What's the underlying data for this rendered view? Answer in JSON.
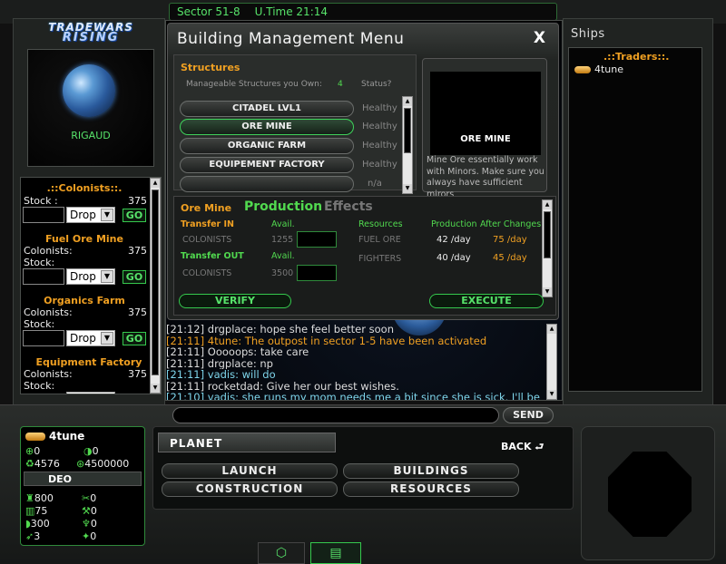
{
  "header": {
    "sector": "Sector 51-8",
    "utime": "U.Time 21:14"
  },
  "logo": {
    "line1": "TRADEWARS",
    "line2": "RISING"
  },
  "planet": {
    "name": "RIGAUD"
  },
  "colonists_panel": {
    "title": ".::Colonists::.",
    "sections": [
      {
        "heading": "",
        "rows": [
          {
            "label": "Stock :",
            "value": "375"
          }
        ]
      },
      {
        "heading": "Fuel Ore Mine",
        "rows": [
          {
            "label": "Colonists:",
            "value": "375"
          },
          {
            "label": "Stock:",
            "value": ""
          }
        ]
      },
      {
        "heading": "Organics Farm",
        "rows": [
          {
            "label": "Colonists:",
            "value": "375"
          },
          {
            "label": "Stock:",
            "value": ""
          }
        ]
      },
      {
        "heading": "Equipment Factory",
        "rows": [
          {
            "label": "Colonists:",
            "value": "375"
          },
          {
            "label": "Stock:",
            "value": ""
          }
        ]
      }
    ],
    "drop_label": "Drop",
    "go_label": "GO"
  },
  "modal": {
    "title": "Building Management Menu",
    "title_ghost": "Building Management Menu",
    "close": "X",
    "structures_heading": "Structures",
    "manageable_label": "Manageable Structures you Own:",
    "manageable_count": "4",
    "status_label": "Status?",
    "structures": [
      {
        "name": "CITADEL LVL1",
        "status": "Healthy"
      },
      {
        "name": "ORE MINE",
        "status": "Healthy"
      },
      {
        "name": "ORGANIC FARM",
        "status": "Healthy"
      },
      {
        "name": "EQUIPEMENT FACTORY",
        "status": "Healthy"
      },
      {
        "name": "",
        "status": "n/a"
      }
    ],
    "preview_title": "ORE MINE",
    "preview_desc": "Mine Ore essentially work with Minors. Make sure you always have sufficient mirors",
    "section_name": "Ore Mine",
    "tab_production": "Production",
    "tab_effects": "Effects",
    "transfer_in": "Transfer IN",
    "transfer_out": "Transfer OUT",
    "avail_label": "Avail.",
    "in_row": {
      "item": "COLONISTS",
      "avail": "1255"
    },
    "out_row": {
      "item": "COLONISTS",
      "avail": "3500"
    },
    "resources_header": "Resources",
    "production_header": "Production",
    "after_changes_header": "After Changes",
    "resources": [
      {
        "name": "FUEL ORE",
        "production": "42 /day",
        "after": "75 /day"
      },
      {
        "name": "FIGHTERS",
        "production": "40 /day",
        "after": "45 /day"
      }
    ],
    "verify": "VERIFY",
    "execute": "EXECUTE"
  },
  "chat": {
    "lines": [
      {
        "time": "[21:12]",
        "text": "drgplace: hope she feel better soon",
        "color": "#dddddd"
      },
      {
        "time": "[21:11]",
        "text": "4tune: The outpost in sector 1-5 have been activated",
        "color": "#f0a022"
      },
      {
        "time": "[21:11]",
        "text": "Ooooops: take care",
        "color": "#dddddd"
      },
      {
        "time": "[21:11]",
        "text": "drgplace: np",
        "color": "#dddddd"
      },
      {
        "time": "[21:11]",
        "text": "vadis: will do",
        "color": "#7fd6ec"
      },
      {
        "time": "[21:11]",
        "text": "rocketdad: Give her our best wishes.",
        "color": "#dddddd"
      },
      {
        "time": "[21:10]",
        "text": "vadis: she runs my mom needs me a bit since she is sick. I'll be",
        "color": "#7fd6ec"
      }
    ],
    "input_value": "",
    "send": "SEND"
  },
  "ships": {
    "title": "Ships",
    "group": ".::Traders::.",
    "items": [
      "4tune"
    ]
  },
  "player": {
    "name": "4tune",
    "stats_top": [
      {
        "icon": "crosshair-icon",
        "value": "0"
      },
      {
        "icon": "yin-icon",
        "value": "0"
      },
      {
        "icon": "recycle-icon",
        "value": "4576"
      },
      {
        "icon": "credits-icon",
        "value": "4500000"
      }
    ],
    "corp": "DEO",
    "stats_bottom": [
      {
        "icon": "ship-icon",
        "value": "800"
      },
      {
        "icon": "tool-icon",
        "value": "0"
      },
      {
        "icon": "cargo-icon",
        "value": "75"
      },
      {
        "icon": "wrench-icon",
        "value": "0"
      },
      {
        "icon": "shield-icon",
        "value": "300"
      },
      {
        "icon": "mine-icon",
        "value": "0"
      },
      {
        "icon": "torpedo-icon",
        "value": "3"
      },
      {
        "icon": "probe-icon",
        "value": "0"
      }
    ]
  },
  "planet_menu": {
    "title": "PLANET",
    "back": "BACK",
    "buttons": [
      "LAUNCH",
      "BUILDINGS",
      "CONSTRUCTION",
      "RESOURCES"
    ]
  },
  "colors": {
    "accent": "#51d94f",
    "orange": "#f0a022",
    "panel": "#000000"
  }
}
